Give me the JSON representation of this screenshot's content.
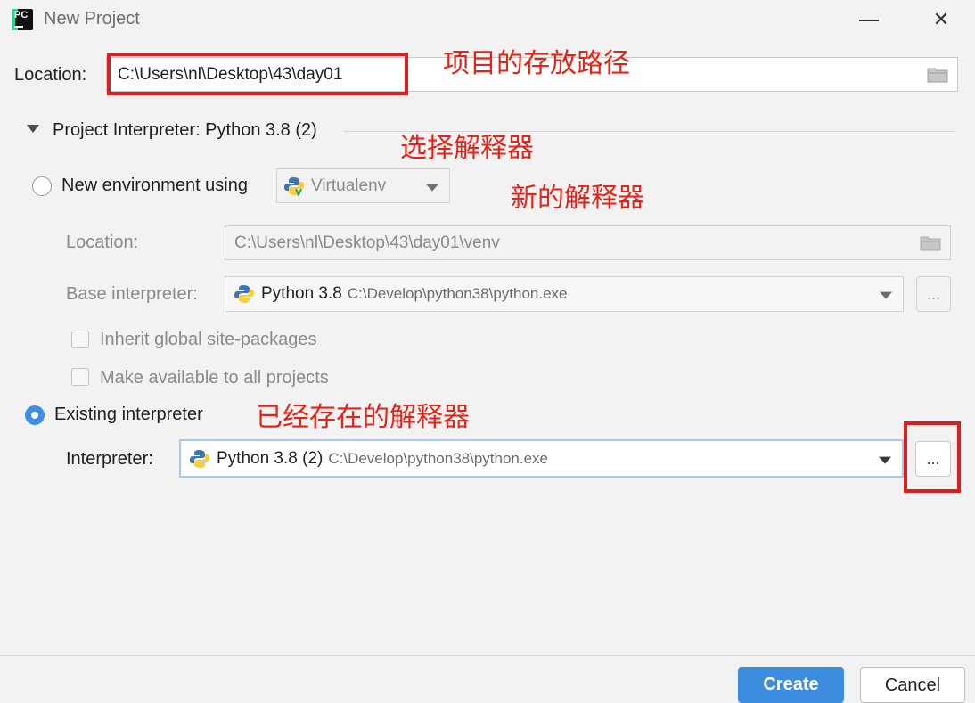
{
  "window": {
    "title": "New Project",
    "minimize_glyph": "—",
    "close_glyph": "✕"
  },
  "location": {
    "label": "Location:",
    "value": "C:\\Users\\nl\\Desktop\\43\\day01"
  },
  "interpreter_section": {
    "title": "Project Interpreter: Python 3.8 (2)"
  },
  "new_env": {
    "label": "New environment using",
    "tool": "Virtualenv",
    "location_label": "Location:",
    "location_value": "C:\\Users\\nl\\Desktop\\43\\day01\\venv",
    "base_label": "Base interpreter:",
    "base_name": "Python 3.8",
    "base_path": "C:\\Develop\\python38\\python.exe",
    "inherit_label": "Inherit global site-packages",
    "available_label": "Make available to all projects",
    "ellipsis": "..."
  },
  "existing": {
    "label": "Existing interpreter",
    "interpreter_label": "Interpreter:",
    "interpreter_name": "Python 3.8 (2)",
    "interpreter_path": "C:\\Develop\\python38\\python.exe",
    "ellipsis": "..."
  },
  "annotations": {
    "path_note": "项目的存放路径",
    "choose_note": "选择解释器",
    "new_note": "新的解释器",
    "existing_note": "已经存在的解释器"
  },
  "footer": {
    "create": "Create",
    "cancel": "Cancel"
  },
  "colors": {
    "annotation_red": "#e1251b",
    "accent_blue": "#3c8de0"
  }
}
